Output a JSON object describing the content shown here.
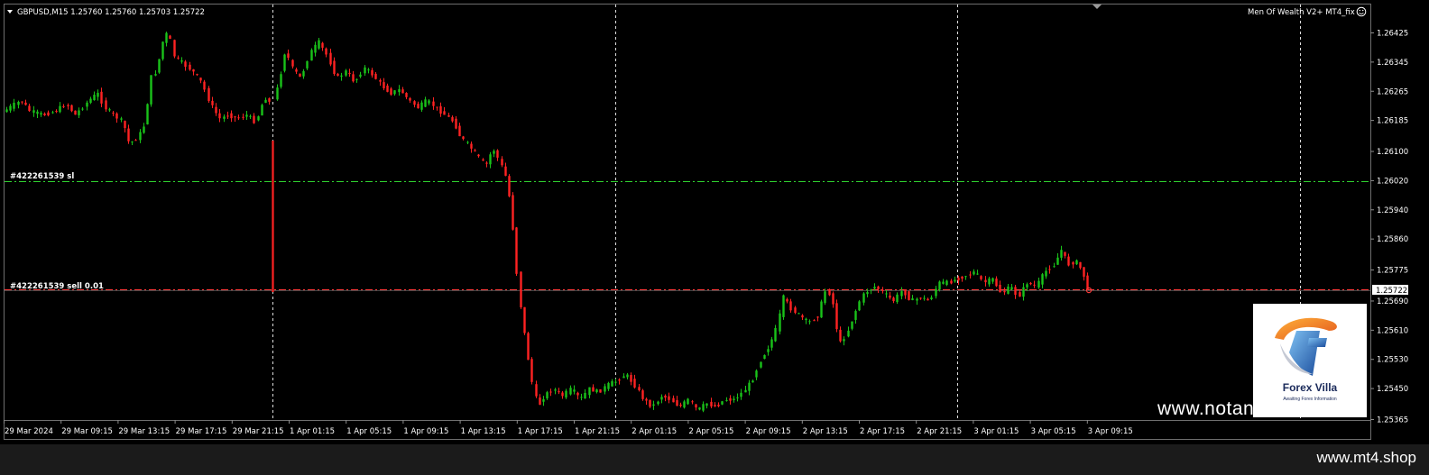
{
  "header": {
    "symbol_info": "GBPUSD,M15  1.25760 1.25760 1.25703 1.25722",
    "indicator": "Men Of Wealth V2+ MT4_fix"
  },
  "order_lines": {
    "sl_label": "#422261539 sl",
    "sell_label": "#422261539 sell 0.01"
  },
  "watermark": "www.notandor.ir",
  "footer": "www.mt4.shop",
  "logo": {
    "name": "Forex Villa",
    "tagline": "Awaiting Forex Information"
  },
  "colors": {
    "background": "#000000",
    "bull": "#19c319",
    "bear": "#ff2222",
    "grid": "#ffffff",
    "sl_line": "#2fd12f",
    "sell_line": "#ff3b3b"
  },
  "chart_data": {
    "type": "candlestick",
    "symbol": "GBPUSD",
    "timeframe": "M15",
    "ohlc_last": {
      "open": 1.2576,
      "high": 1.2576,
      "low": 1.25703,
      "close": 1.25722
    },
    "current_price": "1.25722",
    "ylim": [
      1.2533,
      1.2647
    ],
    "y_ticks": [
      "1.26425",
      "1.26345",
      "1.26265",
      "1.26185",
      "1.26100",
      "1.26020",
      "1.25940",
      "1.25860",
      "1.25775",
      "1.25690",
      "1.25610",
      "1.25530",
      "1.25450",
      "1.25365"
    ],
    "x_ticks": [
      "29 Mar 2024",
      "29 Mar 09:15",
      "29 Mar 13:15",
      "29 Mar 17:15",
      "29 Mar 21:15",
      "1 Apr 01:15",
      "1 Apr 05:15",
      "1 Apr 09:15",
      "1 Apr 13:15",
      "1 Apr 17:15",
      "1 Apr 21:15",
      "2 Apr 01:15",
      "2 Apr 05:15",
      "2 Apr 09:15",
      "2 Apr 13:15",
      "2 Apr 17:15",
      "2 Apr 21:15",
      "3 Apr 01:15",
      "3 Apr 05:15",
      "3 Apr 09:15"
    ],
    "sl_price": 1.2602,
    "sell_price": 1.25722,
    "price_path": [
      [
        0,
        1.262
      ],
      [
        12,
        1.2622
      ],
      [
        25,
        1.2624
      ],
      [
        35,
        1.2621
      ],
      [
        50,
        1.262
      ],
      [
        62,
        1.2621
      ],
      [
        75,
        1.2623
      ],
      [
        85,
        1.262
      ],
      [
        100,
        1.2624
      ],
      [
        110,
        1.2626
      ],
      [
        118,
        1.2622
      ],
      [
        128,
        1.262
      ],
      [
        138,
        1.2618
      ],
      [
        145,
        1.2612
      ],
      [
        155,
        1.2614
      ],
      [
        163,
        1.2618
      ],
      [
        168,
        1.263
      ],
      [
        175,
        1.2632
      ],
      [
        182,
        1.264
      ],
      [
        188,
        1.2643
      ],
      [
        195,
        1.2636
      ],
      [
        205,
        1.2634
      ],
      [
        215,
        1.2632
      ],
      [
        225,
        1.2629
      ],
      [
        235,
        1.2623
      ],
      [
        245,
        1.2619
      ],
      [
        255,
        1.262
      ],
      [
        265,
        1.2619
      ],
      [
        275,
        1.262
      ],
      [
        285,
        1.2618
      ],
      [
        295,
        1.2625
      ],
      [
        302,
        1.2623
      ],
      [
        310,
        1.2628
      ],
      [
        318,
        1.2638
      ],
      [
        325,
        1.2633
      ],
      [
        335,
        1.263
      ],
      [
        345,
        1.2637
      ],
      [
        355,
        1.264
      ],
      [
        365,
        1.2636
      ],
      [
        375,
        1.263
      ],
      [
        385,
        1.2632
      ],
      [
        395,
        1.2629
      ],
      [
        405,
        1.2633
      ],
      [
        415,
        1.2631
      ],
      [
        425,
        1.2628
      ],
      [
        435,
        1.2626
      ],
      [
        445,
        1.2627
      ],
      [
        455,
        1.2624
      ],
      [
        465,
        1.2622
      ],
      [
        475,
        1.2624
      ],
      [
        485,
        1.2622
      ],
      [
        495,
        1.262
      ],
      [
        505,
        1.2618
      ],
      [
        512,
        1.2614
      ],
      [
        520,
        1.2612
      ],
      [
        530,
        1.2609
      ],
      [
        540,
        1.2606
      ],
      [
        548,
        1.2611
      ],
      [
        556,
        1.2607
      ],
      [
        564,
        1.2602
      ],
      [
        570,
        1.259
      ],
      [
        574,
        1.2578
      ],
      [
        580,
        1.2565
      ],
      [
        586,
        1.2555
      ],
      [
        592,
        1.2546
      ],
      [
        598,
        1.254
      ],
      [
        605,
        1.2543
      ],
      [
        615,
        1.2545
      ],
      [
        625,
        1.2543
      ],
      [
        635,
        1.2545
      ],
      [
        645,
        1.2542
      ],
      [
        655,
        1.2545
      ],
      [
        665,
        1.2544
      ],
      [
        675,
        1.2546
      ],
      [
        685,
        1.2547
      ],
      [
        695,
        1.2549
      ],
      [
        705,
        1.2546
      ],
      [
        715,
        1.2542
      ],
      [
        725,
        1.254
      ],
      [
        735,
        1.2543
      ],
      [
        745,
        1.2542
      ],
      [
        755,
        1.254
      ],
      [
        765,
        1.2542
      ],
      [
        775,
        1.2539
      ],
      [
        785,
        1.2541
      ],
      [
        795,
        1.254
      ],
      [
        805,
        1.2542
      ],
      [
        815,
        1.2542
      ],
      [
        825,
        1.2544
      ],
      [
        835,
        1.2547
      ],
      [
        845,
        1.2553
      ],
      [
        855,
        1.2557
      ],
      [
        863,
        1.2562
      ],
      [
        870,
        1.257
      ],
      [
        878,
        1.2567
      ],
      [
        888,
        1.2565
      ],
      [
        898,
        1.2563
      ],
      [
        908,
        1.2565
      ],
      [
        918,
        1.2573
      ],
      [
        925,
        1.2568
      ],
      [
        932,
        1.2557
      ],
      [
        940,
        1.256
      ],
      [
        948,
        1.2565
      ],
      [
        956,
        1.257
      ],
      [
        964,
        1.2572
      ],
      [
        972,
        1.2573
      ],
      [
        982,
        1.2571
      ],
      [
        992,
        1.2569
      ],
      [
        1002,
        1.2572
      ],
      [
        1012,
        1.2569
      ],
      [
        1022,
        1.257
      ],
      [
        1032,
        1.2569
      ],
      [
        1042,
        1.2574
      ],
      [
        1052,
        1.2574
      ],
      [
        1062,
        1.2575
      ],
      [
        1072,
        1.2576
      ],
      [
        1082,
        1.2577
      ],
      [
        1092,
        1.2574
      ],
      [
        1102,
        1.2575
      ],
      [
        1112,
        1.2571
      ],
      [
        1122,
        1.2573
      ],
      [
        1130,
        1.257
      ],
      [
        1140,
        1.2574
      ],
      [
        1150,
        1.2573
      ],
      [
        1160,
        1.2577
      ],
      [
        1170,
        1.2579
      ],
      [
        1178,
        1.2583
      ],
      [
        1186,
        1.2579
      ],
      [
        1194,
        1.258
      ],
      [
        1202,
        1.2577
      ],
      [
        1208,
        1.25722
      ]
    ]
  }
}
